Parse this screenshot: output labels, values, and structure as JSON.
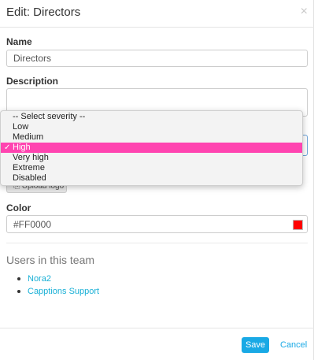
{
  "header": {
    "title": "Edit: Directors",
    "close_symbol": "×"
  },
  "form": {
    "name_label": "Name",
    "name_value": "Directors",
    "description_label": "Description",
    "description_value": "",
    "severity": {
      "options": [
        "-- Select severity --",
        "Low",
        "Medium",
        "High",
        "Very high",
        "Extreme",
        "Disabled"
      ],
      "selected": "High",
      "selected_index": 3,
      "check_mark": "✓"
    },
    "upload_label": "Upload logo",
    "color_label": "Color",
    "color_value": "#FF0000",
    "swatch_color": "#ff0000"
  },
  "users": {
    "section_title": "Users in this team",
    "items": [
      "Nora2",
      "Capptions Support"
    ]
  },
  "footer": {
    "save_label": "Save",
    "cancel_label": "Cancel"
  },
  "colors": {
    "accent": "#19a9e5",
    "selected_option": "#ff44b0"
  }
}
